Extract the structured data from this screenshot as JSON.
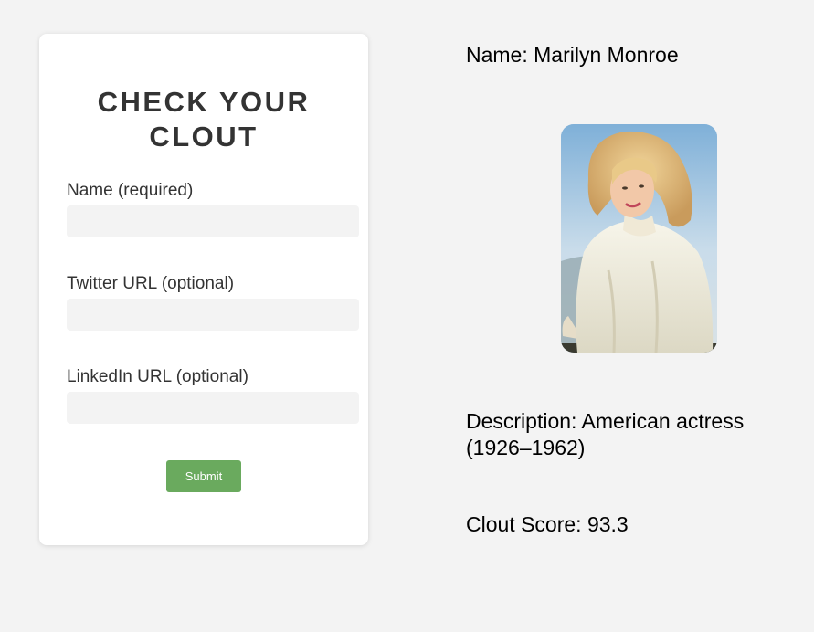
{
  "form": {
    "title": "CHECK YOUR CLOUT",
    "fields": [
      {
        "label": "Name (required)",
        "value": ""
      },
      {
        "label": "Twitter URL (optional)",
        "value": ""
      },
      {
        "label": "LinkedIn URL (optional)",
        "value": ""
      }
    ],
    "submit_label": "Submit"
  },
  "result": {
    "name_line": "Name: Marilyn Monroe",
    "description_line1": "Description: American actress",
    "description_line2": "(1926–1962)",
    "score_line": "Clout Score: 93.3"
  },
  "colors": {
    "background": "#f3f3f3",
    "card": "#ffffff",
    "submit": "#6aaa5e",
    "input": "#f3f3f3"
  }
}
